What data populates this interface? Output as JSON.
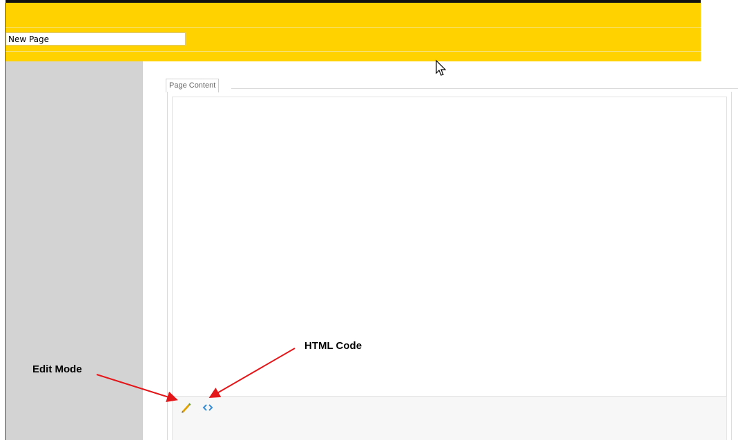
{
  "header": {
    "page_title_value": "New Page"
  },
  "tabs": [
    {
      "label": "Page Content"
    }
  ],
  "toolbar": {
    "buttons": [
      {
        "icon": "pencil-icon"
      },
      {
        "icon": "code-icon"
      }
    ]
  },
  "annotations": {
    "edit_mode": "Edit Mode",
    "html_code": "HTML Code"
  },
  "colors": {
    "header_bg": "#ffd200",
    "sidebar_bg": "#d3d3d3",
    "arrow": "#e3161a",
    "code_icon": "#3a8fd6",
    "pencil_icon": "#e1a100"
  }
}
